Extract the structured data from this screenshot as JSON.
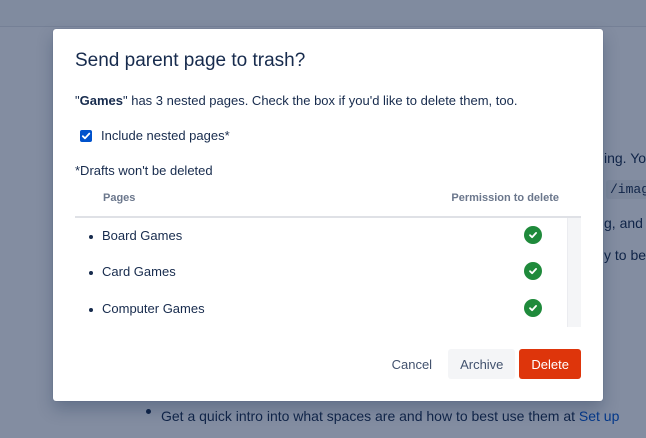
{
  "background": {
    "text_line_1": "ing. Yo",
    "code_snippet": "/imag",
    "text_line_2": "g, and",
    "text_line_3": "y to be",
    "bullet_text": "Get a quick intro into what spaces are and how to best use them at ",
    "bullet_link": "Set up"
  },
  "dialog": {
    "title": "Send parent page to trash?",
    "desc_quote_open": "\"",
    "desc_page_name": "Games",
    "desc_rest": "\" has 3 nested pages. Check the box if you'd like to delete them, too.",
    "checkbox_label": "Include nested pages*",
    "checkbox_checked": true,
    "drafts_note": "*Drafts won't be deleted",
    "table": {
      "col_pages": "Pages",
      "col_permission": "Permission to delete",
      "rows": [
        {
          "label": "Board Games",
          "permission": "check-circle-icon"
        },
        {
          "label": "Card Games",
          "permission": "check-circle-icon"
        },
        {
          "label": "Computer Games",
          "permission": "check-circle-icon"
        }
      ]
    },
    "buttons": {
      "cancel": "Cancel",
      "archive": "Archive",
      "delete": "Delete"
    }
  },
  "colors": {
    "primary": "#0052cc",
    "danger": "#de350b",
    "success": "#1f8a3b"
  }
}
